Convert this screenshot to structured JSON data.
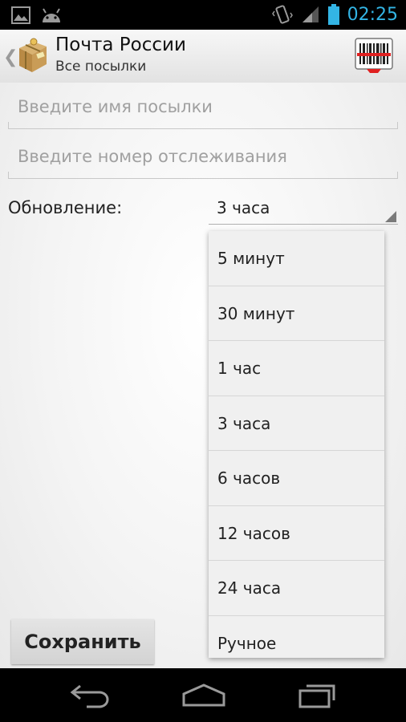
{
  "status_bar": {
    "time": "02:25",
    "left_icons": [
      "image-notification-icon",
      "android-notification-icon"
    ],
    "right_icons": [
      "vibrate-icon",
      "signal-icon",
      "battery-icon"
    ],
    "accent_color": "#33b5e5"
  },
  "action_bar": {
    "title": "Почта России",
    "subtitle": "Все посылки",
    "barcode_icon": "barcode-scan-icon"
  },
  "form": {
    "name_placeholder": "Введите имя посылки",
    "tracking_placeholder": "Введите номер отслеживания",
    "update_label": "Обновление:",
    "update_selected": "3 часа",
    "update_options": [
      "5 минут",
      "30 минут",
      "1 час",
      "3 часа",
      "6 часов",
      "12 часов",
      "24 часа",
      "Ручное"
    ],
    "save_label": "Сохранить"
  },
  "nav_bar": {
    "icons": [
      "back-icon",
      "home-icon",
      "recent-apps-icon"
    ]
  }
}
